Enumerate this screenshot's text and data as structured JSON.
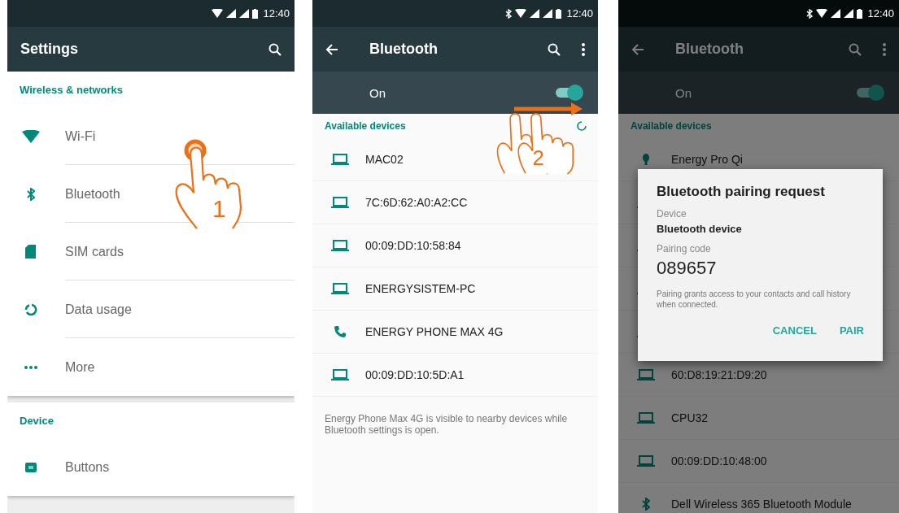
{
  "screens": [
    {
      "kind": "settings",
      "status_bar": {
        "bluetooth": false,
        "time": "12:40"
      },
      "title": "Settings",
      "sections": [
        {
          "header": "Wireless & networks",
          "items": [
            {
              "kind": "wifi",
              "label": "Wi-Fi"
            },
            {
              "kind": "bluetooth",
              "label": "Bluetooth"
            },
            {
              "kind": "sim",
              "label": "SIM cards"
            },
            {
              "kind": "data",
              "label": "Data usage"
            },
            {
              "kind": "more",
              "label": "More"
            }
          ]
        },
        {
          "header": "Device",
          "items": [
            {
              "kind": "buttons",
              "label": "Buttons"
            }
          ]
        }
      ],
      "gesture": {
        "number": "1"
      }
    },
    {
      "kind": "devices",
      "status_bar": {
        "bluetooth": true,
        "time": "12:40"
      },
      "title": "Bluetooth",
      "switch": {
        "label": "On",
        "on": true
      },
      "list_header": "Available devices",
      "scanning": true,
      "devices": [
        {
          "kind": "laptop",
          "label": "MAC02"
        },
        {
          "kind": "laptop",
          "label": "7C:6D:62:A0:A2:CC"
        },
        {
          "kind": "laptop",
          "label": "00:09:DD:10:58:84"
        },
        {
          "kind": "laptop",
          "label": "ENERGYSISTEM-PC"
        },
        {
          "kind": "phone",
          "label": "ENERGY PHONE MAX 4G"
        },
        {
          "kind": "laptop",
          "label": "00:09:DD:10:5D:A1"
        }
      ],
      "footer_note": "Energy Phone Max 4G is visible to nearby devices while Bluetooth settings is open.",
      "gesture": {
        "number": "2"
      }
    },
    {
      "kind": "devices",
      "status_bar": {
        "bluetooth": true,
        "time": "12:40"
      },
      "title": "Bluetooth",
      "switch": {
        "label": "On",
        "on": true
      },
      "list_header": "Available devices",
      "devices": [
        {
          "kind": "bulb",
          "label": "Energy Pro Qi"
        },
        {
          "kind": "laptop"
        },
        {
          "kind": "laptop"
        },
        {
          "kind": "laptop"
        },
        {
          "kind": "laptop"
        },
        {
          "kind": "laptop",
          "label": "60:D8:19:21:D9:20"
        },
        {
          "kind": "laptop",
          "label": "CPU32"
        },
        {
          "kind": "laptop",
          "label": "00:09:DD:10:48:00"
        },
        {
          "kind": "bluetooth",
          "label": "Dell Wireless 365 Bluetooth Module"
        }
      ],
      "dialog": {
        "title": "Bluetooth pairing request",
        "device_caption": "Device",
        "device_name": "Bluetooth device",
        "code_caption": "Pairing code",
        "code": "089657",
        "note": "Pairing grants access to your contacts and call history when connected.",
        "buttons": [
          "CANCEL",
          "PAIR"
        ]
      }
    }
  ]
}
